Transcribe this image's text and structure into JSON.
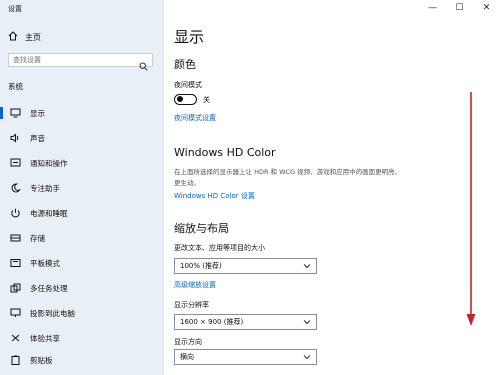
{
  "window": {
    "title": "设置",
    "controls": [
      "—",
      "☐",
      "✕"
    ]
  },
  "sidebar": {
    "home_label": "主页",
    "search_placeholder": "查找设置",
    "group_label": "系统",
    "items": [
      {
        "label": "显示",
        "icon": "monitor-icon",
        "active": true
      },
      {
        "label": "声音",
        "icon": "speaker-icon"
      },
      {
        "label": "通知和操作",
        "icon": "notification-icon"
      },
      {
        "label": "专注助手",
        "icon": "moon-icon"
      },
      {
        "label": "电源和睡眠",
        "icon": "power-icon"
      },
      {
        "label": "存储",
        "icon": "storage-icon"
      },
      {
        "label": "平板模式",
        "icon": "tablet-icon"
      },
      {
        "label": "多任务处理",
        "icon": "multitask-icon"
      },
      {
        "label": "投影到此电脑",
        "icon": "projector-icon"
      },
      {
        "label": "体验共享",
        "icon": "share-icon"
      },
      {
        "label": "剪贴板",
        "icon": "clipboard-icon"
      }
    ]
  },
  "main": {
    "page_title": "显示",
    "color_section": {
      "heading": "颜色",
      "night_mode_label": "夜间模式",
      "night_mode_state": "关",
      "night_mode_settings_link": "夜间模式设置"
    },
    "hdr_section": {
      "heading": "Windows HD Color",
      "description": "在上面所选择的显示器上让 HDR 和 WCG 视频、游戏和应用中的画面更明亮、更生动。",
      "link": "Windows HD Color 设置"
    },
    "scale_section": {
      "heading": "缩放与布局",
      "scale_label": "更改文本、应用等项目的大小",
      "scale_value": "100% (推荐)",
      "advanced_link": "高级缩放设置",
      "resolution_label": "显示分辨率",
      "resolution_value": "1600 × 900 (推荐)",
      "orientation_label": "显示方向",
      "orientation_value": "横向"
    }
  },
  "colors": {
    "accent": "#0a64c8",
    "sidebar_bg": "#e9eff6",
    "annotation_arrow": "#c0262d"
  }
}
